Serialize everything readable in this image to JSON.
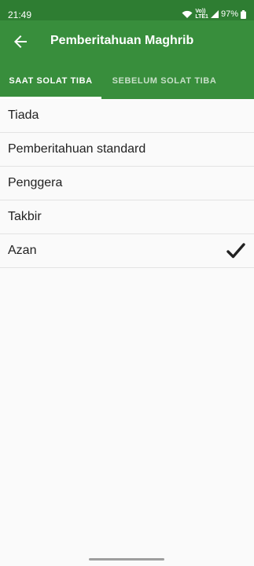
{
  "status_bar": {
    "time": "21:49",
    "network_top": "Vo))",
    "network_bottom": "LTE1",
    "battery": "97%",
    "icons": [
      "wifi-icon",
      "signal-icon",
      "battery-icon"
    ]
  },
  "app_bar": {
    "title": "Pemberitahuan Maghrib",
    "back_icon": "arrow-left-icon",
    "color": "#388e3c"
  },
  "tabs": [
    {
      "label": "SAAT SOLAT TIBA",
      "selected": true
    },
    {
      "label": "SEBELUM SOLAT TIBA",
      "selected": false
    }
  ],
  "options": [
    {
      "label": "Tiada",
      "selected": false
    },
    {
      "label": "Pemberitahuan standard",
      "selected": false
    },
    {
      "label": "Penggera",
      "selected": false
    },
    {
      "label": "Takbir",
      "selected": false
    },
    {
      "label": "Azan",
      "selected": true
    }
  ],
  "check_icon": "checkmark-icon"
}
